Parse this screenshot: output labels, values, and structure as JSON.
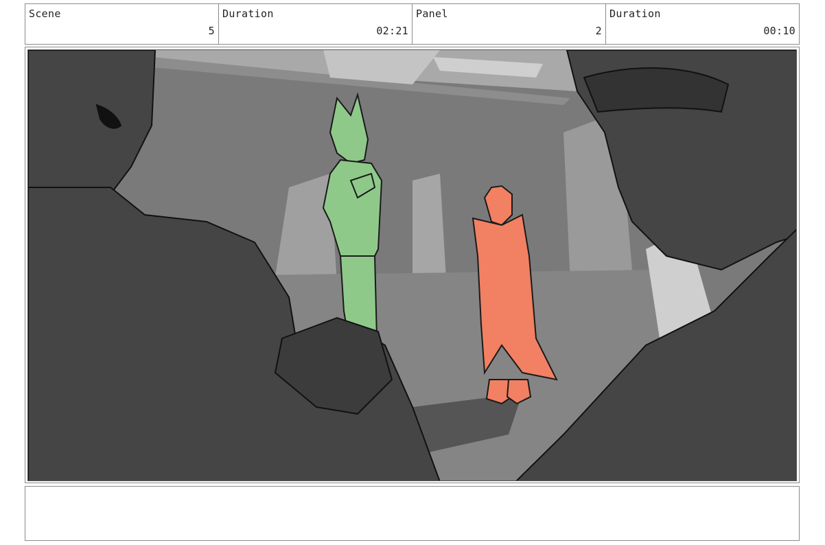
{
  "header": {
    "scene_label": "Scene",
    "scene_value": "5",
    "scene_duration_label": "Duration",
    "scene_duration_value": "02:21",
    "panel_label": "Panel",
    "panel_value": "2",
    "panel_duration_label": "Duration",
    "panel_duration_value": "00:10"
  },
  "colors": {
    "green_character": "#8fc98a",
    "orange_character": "#f28062",
    "foreground_silhouette": "#454545",
    "background_grey": "#7d7d7d"
  },
  "notes": {
    "text": ""
  }
}
